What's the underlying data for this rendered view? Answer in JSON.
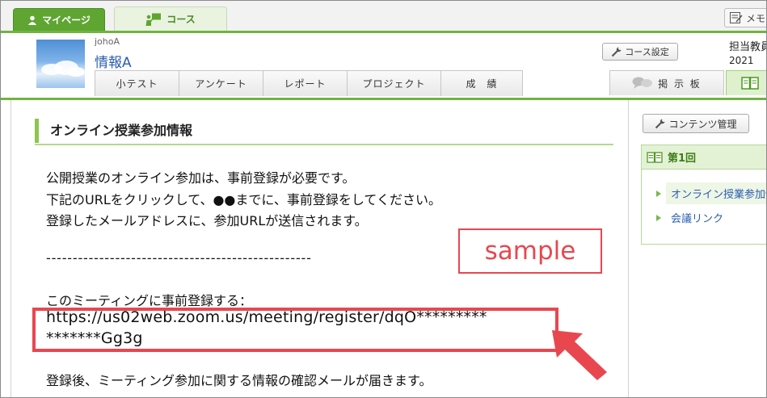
{
  "top_tabs": {
    "mypage": "マイページ",
    "course": "コース",
    "memo": "メモ"
  },
  "course": {
    "code": "johoA",
    "name": "情報A",
    "setting_button": "コース設定",
    "teacher": "担当教員",
    "year": "2021"
  },
  "subnav": [
    "小テスト",
    "アンケート",
    "レポート",
    "プロジェクト",
    "成　績"
  ],
  "board_tab": "掲 示 板",
  "main": {
    "section_title": "オンライン授業参加情報",
    "para1": "公開授業のオンライン参加は、事前登録が必要です。",
    "para2": "下記のURLをクリックして、●●までに、事前登録をしてください。",
    "para3": "登録したメールアドレスに、参加URLが送信されます。",
    "separator": "--------------------------------------------------",
    "register_label": "このミーティングに事前登録する：",
    "url_line1": "https://us02web.zoom.us/meeting/register/dqO*********",
    "url_line2": "*******Gg3g",
    "after_text": "登録後、ミーティング参加に関する情報の確認メールが届きます。",
    "sample_label": "sample"
  },
  "sidebar": {
    "contents_button": "コンテンツ管理",
    "section_head": "第1回",
    "items": [
      "オンライン授業参加情報",
      "会議リンク"
    ]
  },
  "colors": {
    "accent_green": "#6fb43f",
    "highlight_red": "#e8474f",
    "link_blue": "#2a5db0"
  }
}
